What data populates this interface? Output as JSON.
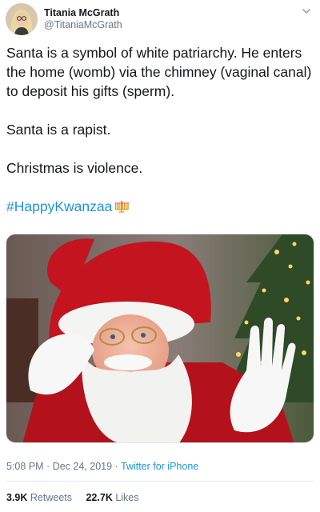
{
  "author": {
    "display_name": "Titania McGrath",
    "handle": "@TitaniaMcGrath"
  },
  "tweet": {
    "lines": [
      "Santa is a symbol of white patriarchy. He enters the home (womb) via the chimney (vaginal canal) to deposit his gifts (sperm).",
      "Santa is a rapist.",
      "Christmas is violence."
    ],
    "hashtag": "#HappyKwanzaa",
    "emoji": "menorah-icon"
  },
  "meta": {
    "time": "5:08 PM",
    "separator": "·",
    "date": "Dec 24, 2019",
    "source": "Twitter for iPhone"
  },
  "stats": {
    "retweets_count": "3.9K",
    "retweets_label": "Retweets",
    "likes_count": "22.7K",
    "likes_label": "Likes"
  },
  "colors": {
    "link": "#1b95e0",
    "text": "#14171a",
    "secondary": "#657786"
  }
}
